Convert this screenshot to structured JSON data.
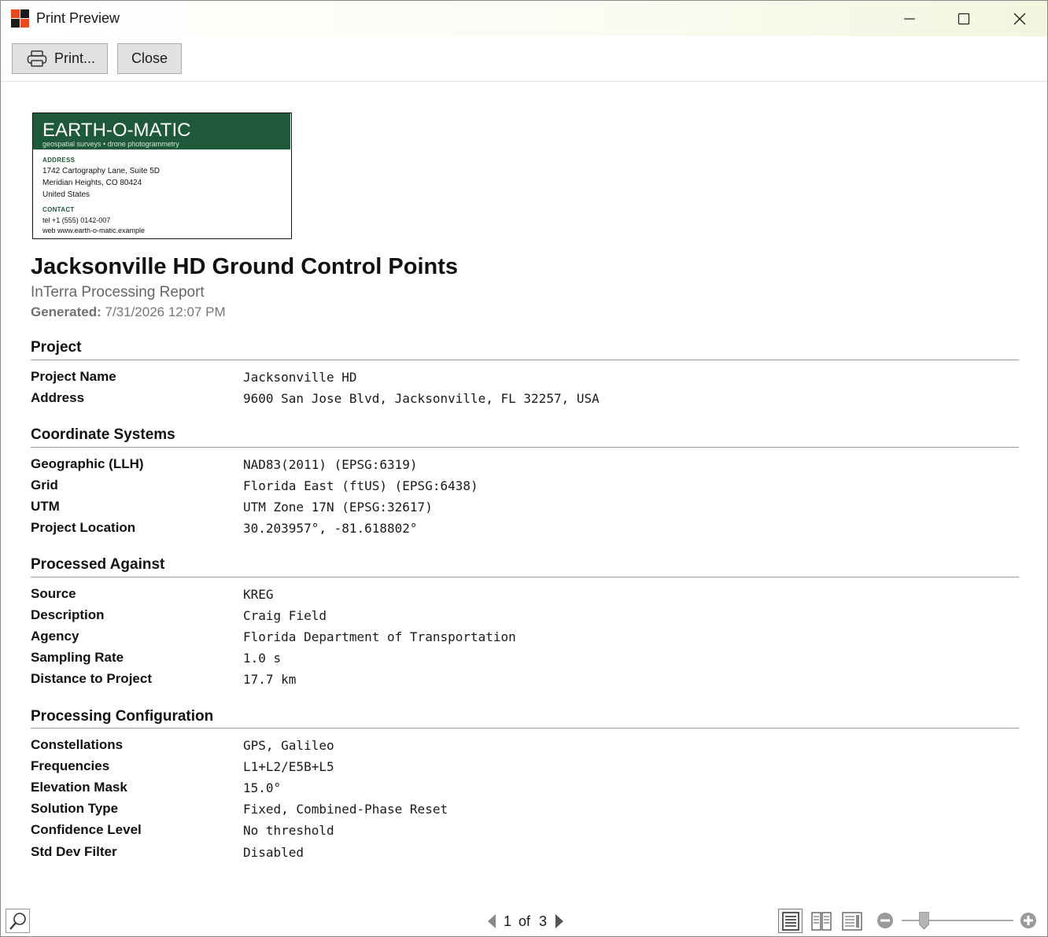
{
  "window": {
    "title": "Print Preview",
    "controls": [
      "minimize",
      "maximize",
      "close"
    ]
  },
  "toolbar": {
    "print_label": "Print...",
    "close_label": "Close"
  },
  "logo": {
    "company": "EARTH-O-MATIC",
    "tagline": "geospatial surveys • drone photogrammetry",
    "address_heading": "ADDRESS",
    "address_lines": [
      "1742 Cartography Lane, Suite 5D",
      "Meridian Heights, CO 80424",
      "United States"
    ],
    "contact_heading": "CONTACT",
    "contact_lines": [
      "tel  +1 (555) 0142-007",
      "web  www.earth-o-matic.example"
    ]
  },
  "report": {
    "title": "Jacksonville HD Ground Control Points",
    "subtitle": "InTerra Processing Report",
    "generated_label": "Generated:",
    "generated_value": "7/31/2026 12:07 PM"
  },
  "sections": [
    {
      "heading": "Project",
      "rows": [
        {
          "label": "Project Name",
          "value": "Jacksonville HD"
        },
        {
          "label": "Address",
          "value": "9600 San Jose Blvd, Jacksonville, FL 32257, USA"
        }
      ]
    },
    {
      "heading": "Coordinate Systems",
      "rows": [
        {
          "label": "Geographic (LLH)",
          "value": "NAD83(2011) (EPSG:6319)"
        },
        {
          "label": "Grid",
          "value": "Florida East (ftUS) (EPSG:6438)"
        },
        {
          "label": "UTM",
          "value": "UTM Zone 17N (EPSG:32617)"
        },
        {
          "label": "Project Location",
          "value": "30.203957°, -81.618802°"
        }
      ]
    },
    {
      "heading": "Processed Against",
      "rows": [
        {
          "label": "Source",
          "value": "KREG"
        },
        {
          "label": "Description",
          "value": "Craig Field"
        },
        {
          "label": "Agency",
          "value": "Florida Department of Transportation"
        },
        {
          "label": "Sampling Rate",
          "value": "1.0 s"
        },
        {
          "label": "Distance to Project",
          "value": "17.7 km"
        }
      ]
    },
    {
      "heading": "Processing Configuration",
      "rows": [
        {
          "label": "Constellations",
          "value": "GPS, Galileo"
        },
        {
          "label": "Frequencies",
          "value": "L1+L2/E5B+L5"
        },
        {
          "label": "Elevation Mask",
          "value": "15.0°"
        },
        {
          "label": "Solution Type",
          "value": "Fixed, Combined-Phase Reset"
        },
        {
          "label": "Confidence Level",
          "value": "No threshold"
        },
        {
          "label": "Std Dev Filter",
          "value": "Disabled"
        }
      ]
    }
  ],
  "statusbar": {
    "current_page": "1",
    "of_label": "of",
    "total_pages": "3",
    "zoom_level": 0.2
  },
  "colors": {
    "logo_green": "#1e5a3a",
    "title_gradient_end": "#f2f6de"
  }
}
